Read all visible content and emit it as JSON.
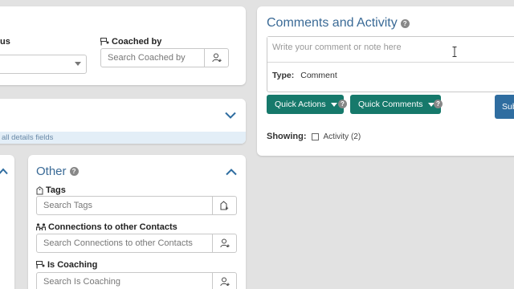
{
  "top_card": {
    "status_label_partial": "us",
    "coached_by_label": "Coached by",
    "coached_by_placeholder": "Search Coached by"
  },
  "mid_card": {
    "footer_text": "all details fields"
  },
  "other_card": {
    "title": "Other",
    "tags_label": "Tags",
    "tags_placeholder": "Search Tags",
    "connections_label": "Connections to other Contacts",
    "connections_placeholder": "Search Connections to other Contacts",
    "is_coaching_label": "Is Coaching",
    "is_coaching_placeholder": "Search Is Coaching"
  },
  "comments_card": {
    "title": "Comments and Activity",
    "comment_placeholder": "Write your comment or note here",
    "type_label": "Type:",
    "type_value": "Comment",
    "quick_actions_label": "Quick Actions",
    "quick_comments_label": "Quick Comments",
    "submit_label": "Sub",
    "showing_label": "Showing:",
    "activity_option": "Activity (2)"
  },
  "colors": {
    "accent_green": "#16796b",
    "accent_blue": "#2f6da0",
    "title_blue": "#3a6a96"
  }
}
